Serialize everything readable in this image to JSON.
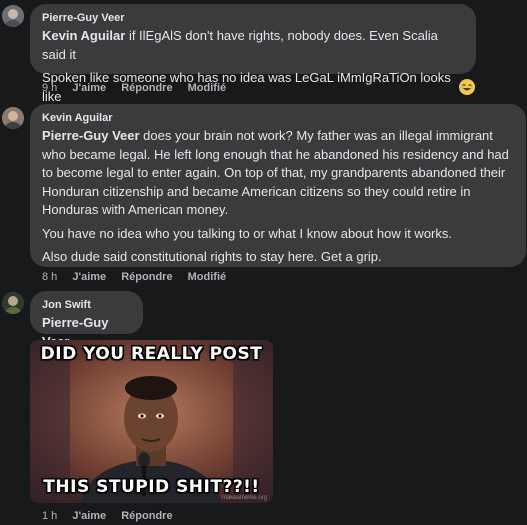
{
  "comments": [
    {
      "author": "Pierre-Guy Veer",
      "paragraphs": [
        {
          "mention": "Kevin Aguilar",
          "text": " if IlEgAlS don't have rights, nobody does. Even Scalia said it"
        },
        {
          "mention": "",
          "text": "Spoken like someone who has no idea was LeGaL iMmIgRaTiOn looks like"
        }
      ],
      "time": "9 h",
      "like": "J'aime",
      "reply": "Répondre",
      "edited": "Modifié",
      "reaction": "laughing-emoji"
    },
    {
      "author": "Kevin Aguilar",
      "paragraphs": [
        {
          "mention": "Pierre-Guy Veer",
          "text": " does your brain not work? My father was an illegal immigrant who became legal. He left long enough that he abandoned his residency and had to become legal to enter again. On top of that, my grandparents abandoned their Honduran citizenship and became American citizens so they could retire in Honduras with American money."
        },
        {
          "mention": "",
          "text": "You have no idea who you talking to or what I know about how it works."
        },
        {
          "mention": "",
          "text": "Also dude said constitutional rights to stay here. Get a grip."
        }
      ],
      "time": "8 h",
      "like": "J'aime",
      "reply": "Répondre",
      "edited": "Modifié"
    },
    {
      "author": "Jon Swift",
      "paragraphs": [
        {
          "mention": "Pierre-Guy Veer",
          "text": ""
        }
      ],
      "meme": {
        "top_text": "DID YOU REALLY POST",
        "bottom_text": "THIS STUPID SHIT??!!",
        "watermark": "makeameme.org"
      },
      "time": "1 h",
      "like": "J'aime",
      "reply": "Répondre"
    }
  ],
  "colors": {
    "background": "#18191a",
    "bubble": "#3a3b3c",
    "text": "#e4e6eb",
    "secondary": "#b0b3b8"
  }
}
